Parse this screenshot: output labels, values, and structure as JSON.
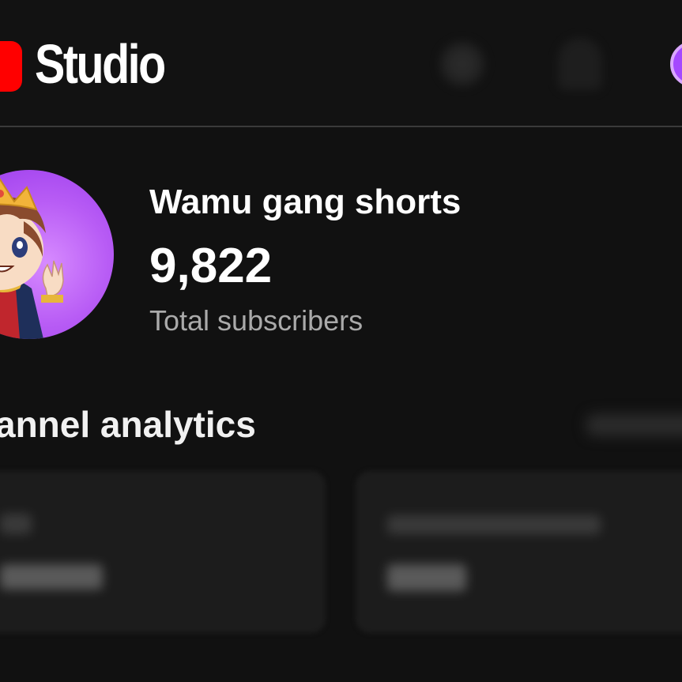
{
  "header": {
    "app_name": "Studio",
    "icons": {
      "logo": "youtube-play-logo",
      "search": "search-icon",
      "notifications": "bell-icon",
      "account": "account-avatar"
    }
  },
  "channel": {
    "name": "Wamu gang shorts",
    "subscriber_count": "9,822",
    "subscriber_label": "Total subscribers"
  },
  "analytics": {
    "title": "annel analytics"
  },
  "colors": {
    "brand_red": "#ff0000",
    "background": "#0f0f0f",
    "avatar_purple": "#b85cf5",
    "secondary_text": "#aaaaaa"
  }
}
